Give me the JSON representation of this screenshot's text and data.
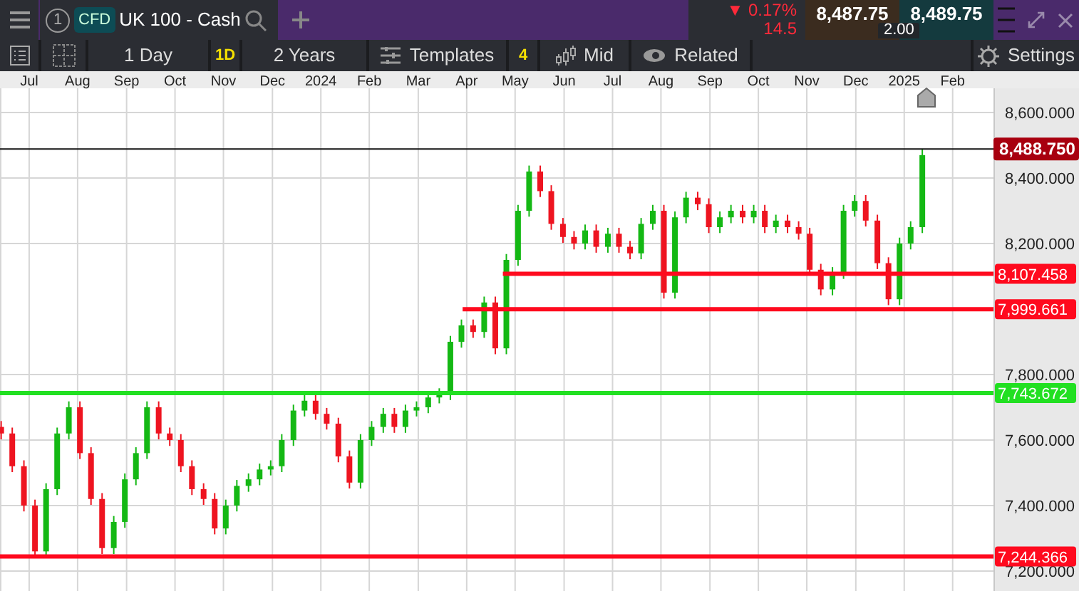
{
  "header": {
    "tab": {
      "number": "1",
      "badge": "CFD",
      "title": "UK 100 - Cash"
    },
    "quote": {
      "change": "▼ 0.17%",
      "change_points": "14.5",
      "sell": "8,487.75",
      "buy": "8,489.75",
      "spread": "2.00"
    }
  },
  "toolbar": {
    "interval": "1 Day",
    "interval_badge": "1D",
    "range": "2 Years",
    "templates": "Templates",
    "templates_count": "4",
    "price_type": "Mid",
    "related": "Related",
    "settings": "Settings"
  },
  "chart": {
    "chart_data": {
      "type": "candlestick",
      "x": [
        2023.452,
        2023.471,
        2023.491,
        2023.51,
        2023.529,
        2023.548,
        2023.568,
        2023.587,
        2023.606,
        2023.625,
        2023.645,
        2023.664,
        2023.683,
        2023.702,
        2023.722,
        2023.741,
        2023.76,
        2023.779,
        2023.799,
        2023.818,
        2023.837,
        2023.856,
        2023.876,
        2023.895,
        2023.914,
        2023.933,
        2023.953,
        2023.972,
        2023.991,
        2024.01,
        2024.03,
        2024.049,
        2024.068,
        2024.087,
        2024.107,
        2024.126,
        2024.145,
        2024.164,
        2024.184,
        2024.203,
        2024.222,
        2024.241,
        2024.261,
        2024.28,
        2024.299,
        2024.318,
        2024.338,
        2024.357,
        2024.376,
        2024.395,
        2024.415,
        2024.434,
        2024.453,
        2024.472,
        2024.492,
        2024.511,
        2024.53,
        2024.549,
        2024.569,
        2024.588,
        2024.607,
        2024.626,
        2024.646,
        2024.665,
        2024.684,
        2024.703,
        2024.723,
        2024.742,
        2024.761,
        2024.78,
        2024.8,
        2024.819,
        2024.838,
        2024.857,
        2024.877,
        2024.896,
        2024.915,
        2024.934,
        2024.954,
        2024.973,
        2024.992,
        2025.011,
        2025.031
      ],
      "ohlc": [
        [
          7640,
          7658,
          7602,
          7620
        ],
        [
          7620,
          7638,
          7502,
          7520
        ],
        [
          7520,
          7538,
          7382,
          7400
        ],
        [
          7400,
          7418,
          7242,
          7260
        ],
        [
          7260,
          7468,
          7242,
          7450
        ],
        [
          7450,
          7638,
          7432,
          7620
        ],
        [
          7620,
          7718,
          7602,
          7700
        ],
        [
          7700,
          7718,
          7542,
          7560
        ],
        [
          7560,
          7578,
          7402,
          7420
        ],
        [
          7420,
          7438,
          7252,
          7270
        ],
        [
          7270,
          7368,
          7252,
          7350
        ],
        [
          7350,
          7498,
          7332,
          7480
        ],
        [
          7480,
          7578,
          7462,
          7560
        ],
        [
          7560,
          7718,
          7542,
          7700
        ],
        [
          7700,
          7718,
          7602,
          7620
        ],
        [
          7620,
          7638,
          7582,
          7600
        ],
        [
          7600,
          7618,
          7502,
          7520
        ],
        [
          7520,
          7538,
          7432,
          7450
        ],
        [
          7450,
          7468,
          7402,
          7420
        ],
        [
          7420,
          7438,
          7312,
          7330
        ],
        [
          7330,
          7418,
          7312,
          7400
        ],
        [
          7400,
          7478,
          7382,
          7460
        ],
        [
          7460,
          7498,
          7442,
          7480
        ],
        [
          7480,
          7528,
          7462,
          7510
        ],
        [
          7510,
          7538,
          7492,
          7520
        ],
        [
          7520,
          7618,
          7502,
          7600
        ],
        [
          7600,
          7708,
          7582,
          7690
        ],
        [
          7690,
          7738,
          7672,
          7720
        ],
        [
          7720,
          7738,
          7662,
          7680
        ],
        [
          7680,
          7698,
          7632,
          7650
        ],
        [
          7650,
          7668,
          7532,
          7550
        ],
        [
          7550,
          7568,
          7452,
          7470
        ],
        [
          7470,
          7618,
          7452,
          7600
        ],
        [
          7600,
          7658,
          7582,
          7640
        ],
        [
          7640,
          7698,
          7622,
          7680
        ],
        [
          7680,
          7698,
          7622,
          7640
        ],
        [
          7640,
          7708,
          7622,
          7690
        ],
        [
          7690,
          7718,
          7672,
          7700
        ],
        [
          7700,
          7748,
          7682,
          7730
        ],
        [
          7730,
          7758,
          7712,
          7740
        ],
        [
          7740,
          7918,
          7722,
          7900
        ],
        [
          7900,
          7968,
          7882,
          7950
        ],
        [
          7950,
          7968,
          7912,
          7930
        ],
        [
          7930,
          8038,
          7912,
          8020
        ],
        [
          8020,
          8038,
          7862,
          7880
        ],
        [
          7880,
          8168,
          7862,
          8150
        ],
        [
          8150,
          8318,
          8132,
          8300
        ],
        [
          8300,
          8438,
          8282,
          8420
        ],
        [
          8420,
          8438,
          8342,
          8360
        ],
        [
          8360,
          8378,
          8242,
          8260
        ],
        [
          8260,
          8278,
          8202,
          8220
        ],
        [
          8220,
          8238,
          8182,
          8200
        ],
        [
          8200,
          8258,
          8182,
          8240
        ],
        [
          8240,
          8258,
          8172,
          8190
        ],
        [
          8190,
          8248,
          8172,
          8230
        ],
        [
          8230,
          8248,
          8172,
          8190
        ],
        [
          8190,
          8208,
          8152,
          8170
        ],
        [
          8170,
          8278,
          8152,
          8260
        ],
        [
          8260,
          8318,
          8242,
          8300
        ],
        [
          8300,
          8318,
          8032,
          8050
        ],
        [
          8050,
          8298,
          8032,
          8280
        ],
        [
          8280,
          8358,
          8262,
          8340
        ],
        [
          8340,
          8358,
          8302,
          8320
        ],
        [
          8320,
          8338,
          8232,
          8250
        ],
        [
          8250,
          8298,
          8232,
          8280
        ],
        [
          8280,
          8318,
          8262,
          8300
        ],
        [
          8300,
          8318,
          8262,
          8280
        ],
        [
          8280,
          8318,
          8262,
          8300
        ],
        [
          8300,
          8318,
          8232,
          8250
        ],
        [
          8250,
          8288,
          8232,
          8270
        ],
        [
          8270,
          8288,
          8232,
          8250
        ],
        [
          8250,
          8268,
          8212,
          8230
        ],
        [
          8230,
          8248,
          8102,
          8120
        ],
        [
          8120,
          8138,
          8042,
          8060
        ],
        [
          8060,
          8128,
          8042,
          8110
        ],
        [
          8110,
          8318,
          8092,
          8300
        ],
        [
          8300,
          8348,
          8282,
          8330
        ],
        [
          8330,
          8348,
          8252,
          8270
        ],
        [
          8270,
          8288,
          8122,
          8140
        ],
        [
          8140,
          8158,
          8012,
          8030
        ],
        [
          8030,
          8218,
          8012,
          8200
        ],
        [
          8200,
          8268,
          8182,
          8250
        ],
        [
          8250,
          8488,
          8232,
          8470
        ]
      ],
      "xlim": [
        2023.45,
        2025.153
      ],
      "ylim": [
        7139,
        8674
      ],
      "grid": true,
      "xticks": [
        {
          "value": 2023.5,
          "label": "Jul"
        },
        {
          "value": 2023.583,
          "label": "Aug"
        },
        {
          "value": 2023.667,
          "label": "Sep"
        },
        {
          "value": 2023.75,
          "label": "Oct"
        },
        {
          "value": 2023.833,
          "label": "Nov"
        },
        {
          "value": 2023.917,
          "label": "Dec"
        },
        {
          "value": 2024,
          "label": "2024"
        },
        {
          "value": 2024.083,
          "label": "Feb"
        },
        {
          "value": 2024.167,
          "label": "Mar"
        },
        {
          "value": 2024.25,
          "label": "Apr"
        },
        {
          "value": 2024.333,
          "label": "May"
        },
        {
          "value": 2024.417,
          "label": "Jun"
        },
        {
          "value": 2024.5,
          "label": "Jul"
        },
        {
          "value": 2024.583,
          "label": "Aug"
        },
        {
          "value": 2024.667,
          "label": "Sep"
        },
        {
          "value": 2024.75,
          "label": "Oct"
        },
        {
          "value": 2024.833,
          "label": "Nov"
        },
        {
          "value": 2024.917,
          "label": "Dec"
        },
        {
          "value": 2025,
          "label": "2025"
        },
        {
          "value": 2025.083,
          "label": "Feb"
        }
      ],
      "yticks": [
        {
          "value": 7200,
          "label": "7,200.000"
        },
        {
          "value": 7400,
          "label": "7,400.000"
        },
        {
          "value": 7600,
          "label": "7,600.000"
        },
        {
          "value": 7800,
          "label": "7,800.000"
        },
        {
          "value": 8200,
          "label": "8,200.000"
        },
        {
          "value": 8400,
          "label": "8,400.000"
        },
        {
          "value": 8600,
          "label": "8,600.000"
        }
      ],
      "ref_lines": [
        {
          "axis": "y",
          "value": 8488.75,
          "color": "#111111"
        },
        {
          "axis": "y",
          "value": 8107.458,
          "label": "8,107.458",
          "color": "#ff0a1e"
        },
        {
          "axis": "y",
          "value": 7999.661,
          "label": "7,999.661",
          "color": "#ff0a1e"
        },
        {
          "axis": "y",
          "value": 7743.672,
          "label": "7,743.672",
          "color": "#22e022"
        },
        {
          "axis": "y",
          "value": 7244.366,
          "label": "7,244.366",
          "color": "#ff0a1e"
        }
      ]
    },
    "current_price": {
      "label": "8,488.750"
    }
  }
}
